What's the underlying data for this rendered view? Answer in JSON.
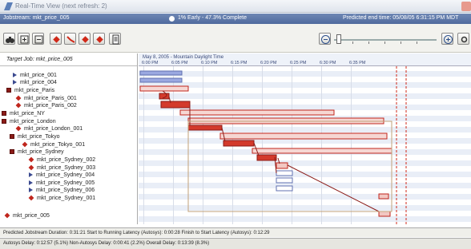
{
  "window": {
    "title": "Real-Time View (next refresh: 2)"
  },
  "jobbar": {
    "jobstream": "Jobstream: mkt_price_005",
    "status": "1% Early -  47.3% Complete",
    "predicted": "Predicted end time: 05/08/05 6:31:15 PM MDT"
  },
  "tree": {
    "target": "Target Job: mkt_price_005",
    "items": [
      {
        "label": "mkt_price_001",
        "marker": "tri"
      },
      {
        "label": "mkt_price_004",
        "marker": "tri"
      },
      {
        "label": "mkt_price_Paris",
        "marker": "box"
      },
      {
        "label": "mkt_price_Paris_001",
        "marker": "dia"
      },
      {
        "label": "mkt_price_Paris_002",
        "marker": "dia"
      },
      {
        "label": "mkt_price_NY",
        "marker": "box"
      },
      {
        "label": "mkt_price_London",
        "marker": "box"
      },
      {
        "label": "mkt_price_London_001",
        "marker": "dia"
      },
      {
        "label": "mkt_price_Tokyo",
        "marker": "box"
      },
      {
        "label": "mkt_price_Tokyo_001",
        "marker": "dia"
      },
      {
        "label": "mkt_price_Sydney",
        "marker": "box"
      },
      {
        "label": "mkt_price_Sydney_002",
        "marker": "dia"
      },
      {
        "label": "mkt_price_Sydney_003",
        "marker": "dia"
      },
      {
        "label": "mkt_price_Sydney_004",
        "marker": "tri"
      },
      {
        "label": "mkt_price_Sydney_005",
        "marker": "tri"
      },
      {
        "label": "mkt_price_Sydney_006",
        "marker": "tri"
      },
      {
        "label": "mkt_price_Sydney_001",
        "marker": "dia"
      },
      {
        "label": "mkt_price_005",
        "marker": "dia"
      }
    ]
  },
  "gantt": {
    "date": "May 8, 2005 - Mountain Daylight Time",
    "ticks": [
      "6:00 PM",
      "6:05 PM",
      "6:10 PM",
      "6:15 PM",
      "6:20 PM",
      "6:25 PM",
      "6:30 PM",
      "6:35 PM"
    ]
  },
  "status": {
    "line1": "Predicted Jobstream Duration: 0:31:21  Start to Running Latency (Autosys): 0:00:28  Finish to Start Latency (Autosys): 0:12:29",
    "line2": "Autosys Delay: 0:12:57 (5.1%)   Non-Autosys Delay: 0:00:41 (2.2%)  Overall Delay: 0:13:39 (8.3%)"
  },
  "colors": {
    "planned": "#9aa8e0",
    "running": "#d33a2c",
    "late": "#f2c7c2",
    "accent": "#5a73a8"
  }
}
